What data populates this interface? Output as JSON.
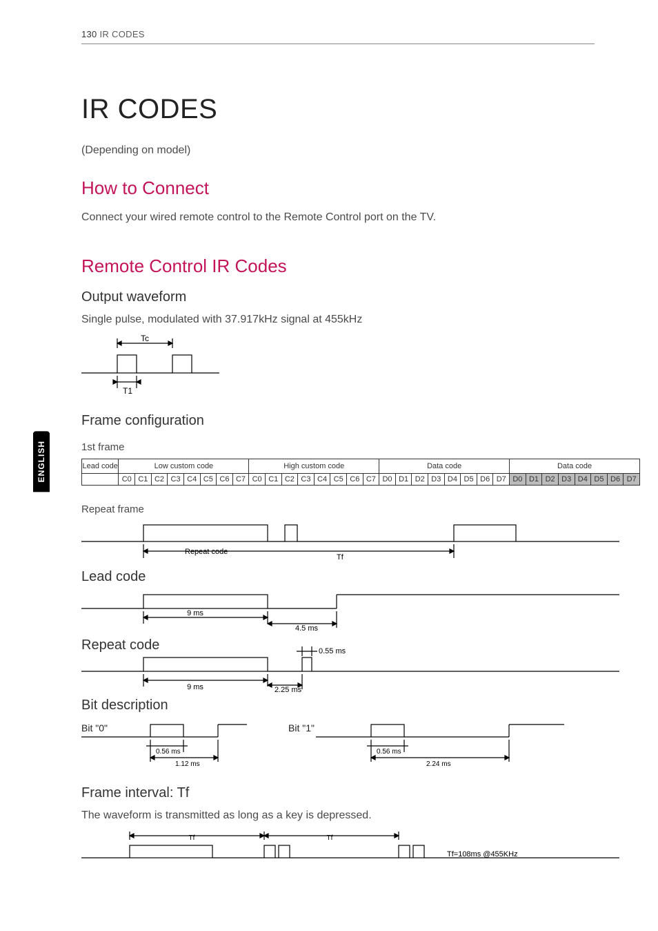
{
  "header": {
    "page_number": "130",
    "section_label": "IR CODES"
  },
  "side_tab": "ENGLISH",
  "title": "IR CODES",
  "depending_note": "(Depending on model)",
  "connect": {
    "heading": "How to Connect",
    "body": "Connect your wired remote control to the Remote Control port on the TV."
  },
  "remote": {
    "heading": "Remote Control IR Codes",
    "output_waveform": {
      "heading": "Output waveform",
      "body": "Single pulse, modulated with 37.917kHz signal at 455kHz",
      "labels": {
        "tc": "Tc",
        "t1": "T1"
      }
    },
    "frame_config": {
      "heading": "Frame configuration",
      "first_frame_label": "1st frame",
      "columns": {
        "lead": "Lead code",
        "low": "Low custom code",
        "high": "High custom code",
        "data1": "Data code",
        "data2": "Data code"
      },
      "bits_c": [
        "C0",
        "C1",
        "C2",
        "C3",
        "C4",
        "C5",
        "C6",
        "C7"
      ],
      "bits_d": [
        "D0",
        "D1",
        "D2",
        "D3",
        "D4",
        "D5",
        "D6",
        "D7"
      ],
      "repeat_frame_label": "Repeat frame",
      "repeat_code_label": "Repeat  code",
      "tf_label": "Tf"
    },
    "lead_code": {
      "heading": "Lead code",
      "t9": "9 ms",
      "t45": "4.5 ms"
    },
    "repeat_code": {
      "heading": "Repeat code",
      "t9": "9 ms",
      "t225": "2.25 ms",
      "t055": "0.55 ms"
    },
    "bit_desc": {
      "heading": "Bit description",
      "bit0": "Bit \"0\"",
      "bit1": "Bit \"1\"",
      "t056_a": "0.56 ms",
      "t056_b": "0.56 ms",
      "t112": "1.12 ms",
      "t224": "2.24 ms"
    },
    "frame_interval": {
      "heading": "Frame interval: Tf",
      "body": "The waveform is transmitted as long as a key is depressed.",
      "tf1": "Tf",
      "tf2": "Tf",
      "note": "Tf=108ms @455KHz"
    }
  }
}
